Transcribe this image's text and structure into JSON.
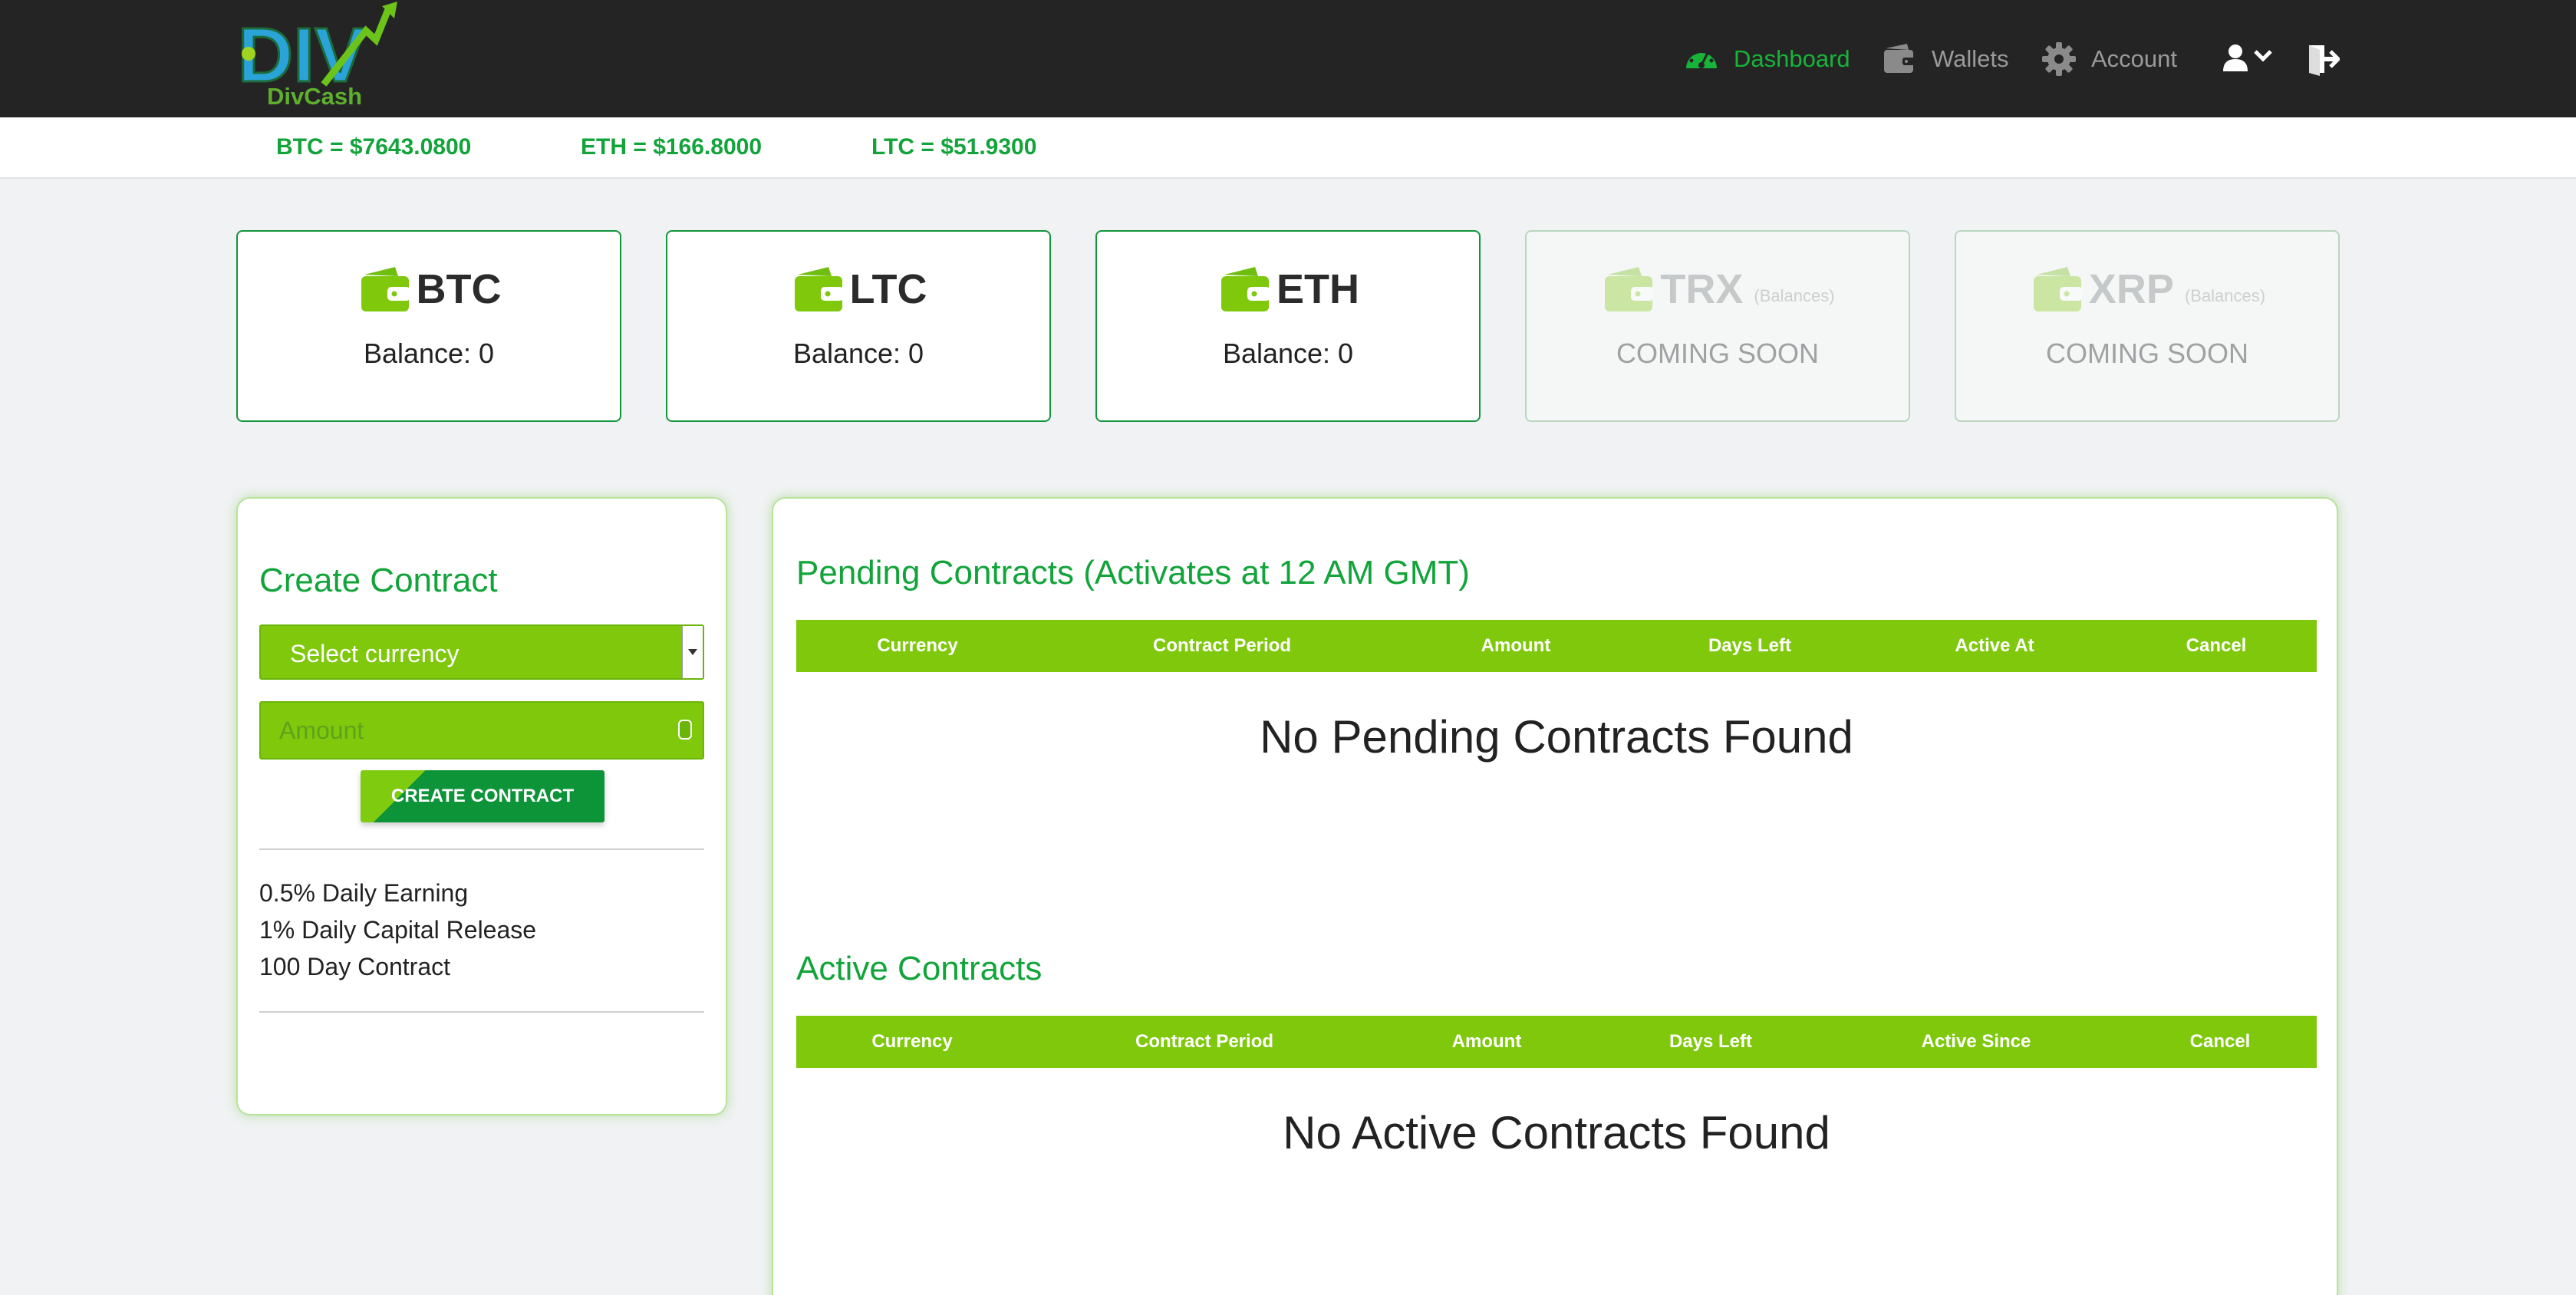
{
  "brand": {
    "name": "DivCash",
    "logo_letters": "DIV"
  },
  "nav": {
    "dashboard": "Dashboard",
    "wallets": "Wallets",
    "account": "Account"
  },
  "ticker": {
    "btc": "BTC = $7643.0800",
    "eth": "ETH = $166.8000",
    "ltc": "LTC = $51.9300"
  },
  "cards": [
    {
      "coin": "BTC",
      "text": "Balance: 0"
    },
    {
      "coin": "LTC",
      "text": "Balance: 0"
    },
    {
      "coin": "ETH",
      "text": "Balance: 0"
    },
    {
      "coin": "TRX",
      "sub": "(Balances)",
      "text": "COMING SOON"
    },
    {
      "coin": "XRP",
      "sub": "(Balances)",
      "text": "COMING SOON"
    }
  ],
  "create": {
    "title": "Create Contract",
    "select_value": "Select currency",
    "amount_placeholder": "Amount",
    "button": "CREATE CONTRACT",
    "features": [
      "0.5% Daily Earning",
      "1% Daily Capital Release",
      "100 Day Contract"
    ]
  },
  "pending": {
    "title": "Pending Contracts (Activates at 12 AM GMT)",
    "columns": [
      "Currency",
      "Contract Period",
      "Amount",
      "Days Left",
      "Active At",
      "Cancel"
    ],
    "empty": "No Pending Contracts Found"
  },
  "active": {
    "title": "Active Contracts",
    "columns": [
      "Currency",
      "Contract Period",
      "Amount",
      "Days Left",
      "Active Since",
      "Cancel"
    ],
    "empty": "No Active Contracts Found"
  },
  "colors": {
    "accent": "#12a43a",
    "table_header": "#7fc80c",
    "topbar": "#242424"
  }
}
